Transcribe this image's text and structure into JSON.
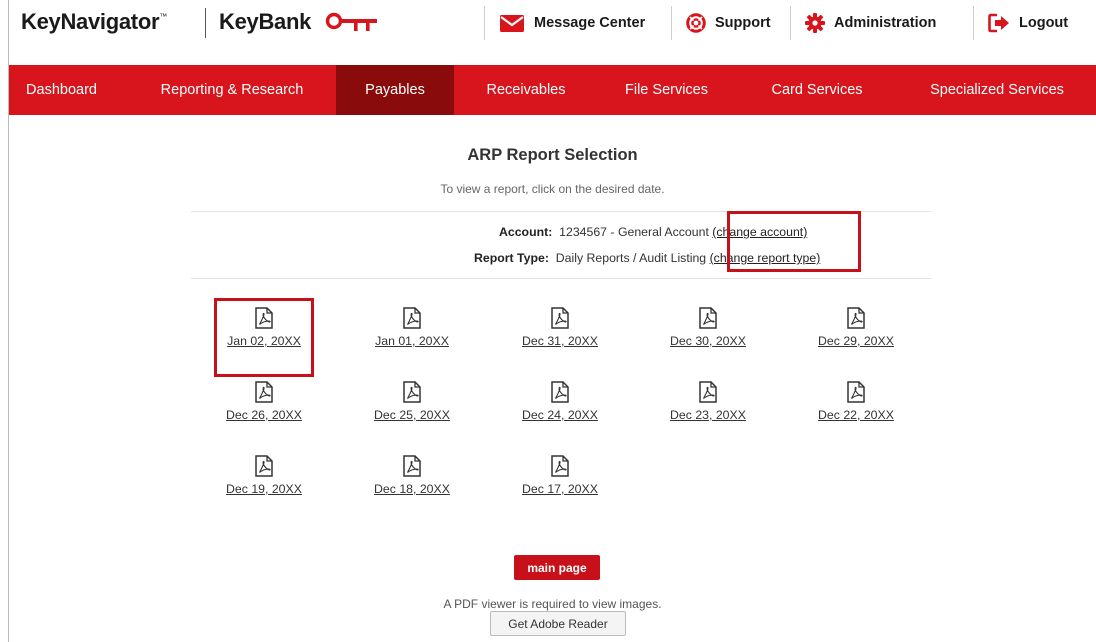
{
  "header": {
    "brand_keynavigator": "KeyNavigator",
    "brand_tm": "™",
    "brand_keybank": "KeyBank",
    "utility": {
      "message_center": "Message Center",
      "support": "Support",
      "administration": "Administration",
      "logout": "Logout"
    }
  },
  "nav": {
    "tabs": [
      {
        "label": "Dashboard"
      },
      {
        "label": "Reporting & Research"
      },
      {
        "label": "Payables"
      },
      {
        "label": "Receivables"
      },
      {
        "label": "File Services"
      },
      {
        "label": "Card Services"
      },
      {
        "label": "Specialized Services"
      }
    ],
    "active": "Payables"
  },
  "page": {
    "title": "ARP Report Selection",
    "subtitle": "To view a report, click on the desired date.",
    "account_label": "Account:",
    "account_value": "1234567 - General Account",
    "change_account": "(change account)",
    "report_type_label": "Report Type:",
    "report_type_value": "Daily Reports / Audit Listing",
    "change_report_type": "(change report type)"
  },
  "reports": [
    "Jan 02, 20XX",
    "Jan 01, 20XX",
    "Dec 31, 20XX",
    "Dec 30, 20XX",
    "Dec 29, 20XX",
    "Dec 26, 20XX",
    "Dec 25, 20XX",
    "Dec 24, 20XX",
    "Dec 23, 20XX",
    "Dec 22, 20XX",
    "Dec 19, 20XX",
    "Dec 18, 20XX",
    "Dec 17, 20XX"
  ],
  "buttons": {
    "main_page": "main page",
    "pdf_note": "A PDF viewer is required to view images.",
    "get_adobe": "Get Adobe Reader"
  },
  "colors": {
    "brand_red": "#d8141c",
    "active_tab": "#8a0b0b",
    "highlight": "#c8101a"
  },
  "icons": {
    "message": "envelope-icon",
    "support": "lifebuoy-icon",
    "administration": "gear-icon",
    "logout": "logout-icon",
    "report": "pdf-file-icon"
  }
}
